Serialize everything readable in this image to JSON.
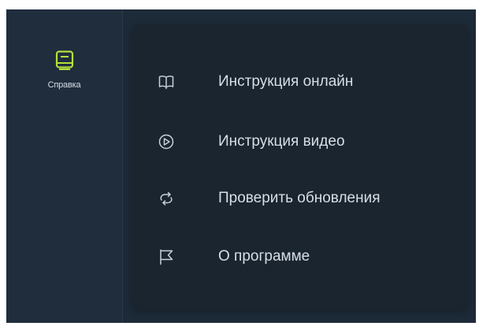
{
  "sidebar": {
    "items": [
      {
        "label": "Справка",
        "icon": "help-book-icon",
        "active": true,
        "accent_color": "#b5e03a"
      }
    ]
  },
  "help_menu": {
    "items": [
      {
        "label": "Инструкция онлайн",
        "icon": "open-book-icon"
      },
      {
        "label": "Инструкция видео",
        "icon": "play-circle-icon"
      },
      {
        "label": "Проверить обновления",
        "icon": "refresh-icon"
      },
      {
        "label": "О программе",
        "icon": "flag-icon"
      }
    ]
  },
  "colors": {
    "sidebar_bg": "#1f2d3d",
    "panel_bg": "#1a252f",
    "text": "#d8dee6",
    "accent": "#b5e03a"
  }
}
